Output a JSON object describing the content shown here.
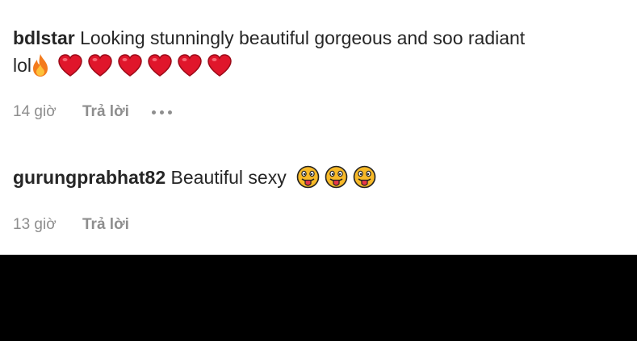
{
  "comments": [
    {
      "username": "bdlstar",
      "text_line1": "Looking stunningly beautiful gorgeous and soo radiant",
      "text_line2": "lol",
      "emojis": [
        "fire-emoji",
        "red-heart-emoji",
        "red-heart-emoji",
        "red-heart-emoji",
        "red-heart-emoji",
        "red-heart-emoji",
        "red-heart-emoji"
      ],
      "time": "14 giờ",
      "reply_label": "Trả lời",
      "has_more_options": true
    },
    {
      "username": "gurungprabhat82",
      "text": "Beautiful sexy",
      "emojis": [
        "face-with-tongue-emoji",
        "face-with-tongue-emoji",
        "face-with-tongue-emoji"
      ],
      "time": "13 giờ",
      "reply_label": "Trả lời",
      "has_more_options": false
    }
  ],
  "colors": {
    "text": "#262626",
    "secondary": "#8e8e8e",
    "background": "#ffffff",
    "bottom_bar": "#000000",
    "heart": "#e0162b",
    "emoji_face": "#f7b928"
  }
}
